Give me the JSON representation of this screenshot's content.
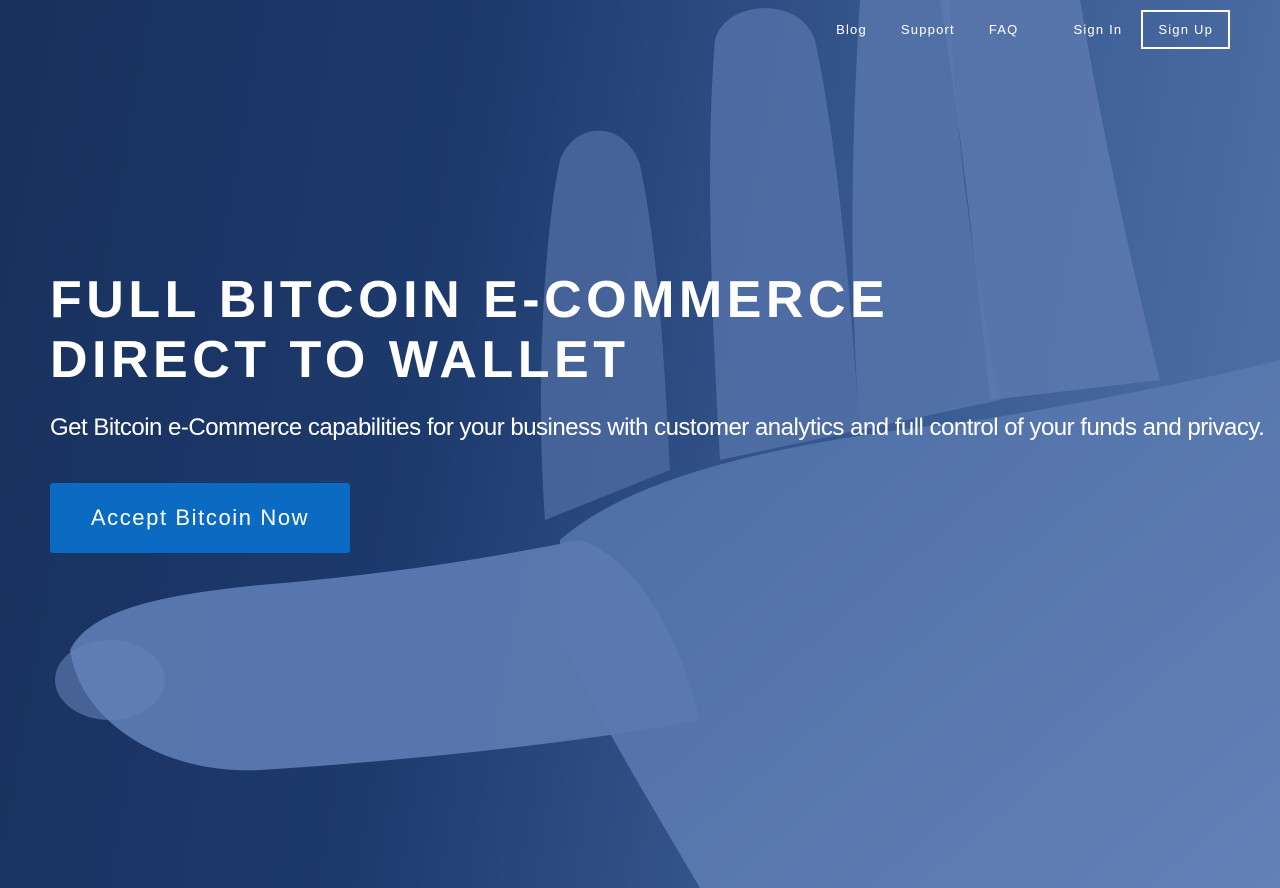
{
  "nav": {
    "links": [
      "Blog",
      "Support",
      "FAQ"
    ],
    "sign_in": "Sign In",
    "sign_up": "Sign Up"
  },
  "hero": {
    "headline_line1": "FULL BITCOIN E-COMMERCE",
    "headline_line2": "DIRECT TO WALLET",
    "subheadline": "Get Bitcoin e-Commerce capabilities for your business with customer analytics and full control of your funds and privacy.",
    "cta_label": "Accept Bitcoin Now",
    "background_image": "open-palm-hand-photo"
  },
  "colors": {
    "overlay_dark": "#1a3362",
    "overlay_light": "#6b8fca",
    "cta_blue": "#0b6bc3",
    "text": "#ffffff"
  }
}
